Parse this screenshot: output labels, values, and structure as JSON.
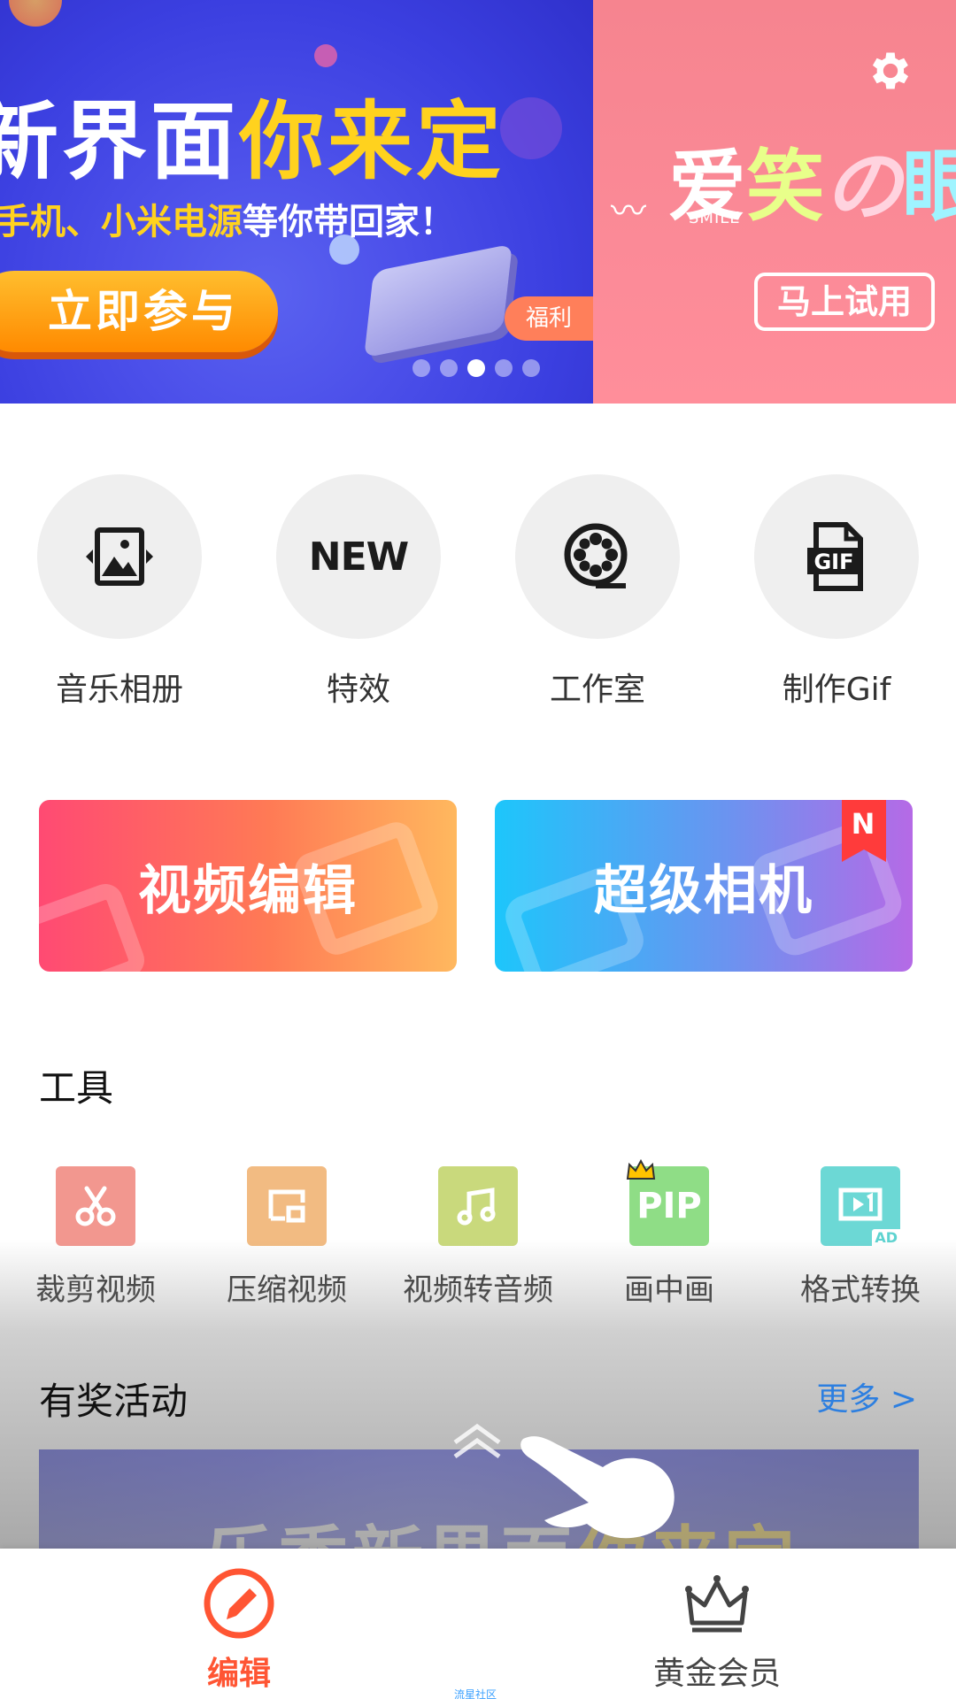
{
  "banner": {
    "main_headline_part1": "新界面",
    "main_headline_part2": "你来定",
    "main_sub_part1": "手机、小米电源",
    "main_sub_part2": "等你带回家！",
    "join_button": "立即参与",
    "fuli_tag": "福利",
    "pager": {
      "count": 5,
      "active_index": 2
    },
    "side_title": [
      "爱",
      "笑",
      "の",
      "眼"
    ],
    "side_smile": "SMILE",
    "try_button": "马上试用"
  },
  "quick_entries": [
    {
      "label": "音乐相册",
      "icon": "photo-album-icon"
    },
    {
      "label": "特效",
      "icon": "new-badge-icon",
      "icon_text": "NEW"
    },
    {
      "label": "工作室",
      "icon": "film-reel-icon"
    },
    {
      "label": "制作Gif",
      "icon": "gif-file-icon",
      "icon_text": "GIF"
    }
  ],
  "feature_cards": {
    "video_edit": "视频编辑",
    "super_camera": "超级相机",
    "new_badge": "N"
  },
  "tools": {
    "title": "工具",
    "items": [
      {
        "label": "裁剪视频",
        "icon": "scissors-icon",
        "color": "#f2978f"
      },
      {
        "label": "压缩视频",
        "icon": "compress-icon",
        "color": "#f2bb82"
      },
      {
        "label": "视频转音频",
        "icon": "music-note-icon",
        "color": "#c9d97c"
      },
      {
        "label": "画中画",
        "icon": "pip-icon",
        "color": "#8fdd86",
        "icon_text": "PIP"
      },
      {
        "label": "格式转换",
        "icon": "format-convert-icon",
        "color": "#6cd8d5",
        "badge": "AD"
      }
    ]
  },
  "activities": {
    "title": "有奖活动",
    "more": "更多 >",
    "promo_part1": "乐秀新界面",
    "promo_part2": "你来定"
  },
  "bottom_nav": {
    "edit": "编辑",
    "vip": "黄金会员"
  },
  "watermark": "流星社区",
  "colors": {
    "accent": "#ff5533",
    "link": "#2d7fe0",
    "banner_blue": "#3b3fe0",
    "banner_pink": "#fb8a97"
  }
}
